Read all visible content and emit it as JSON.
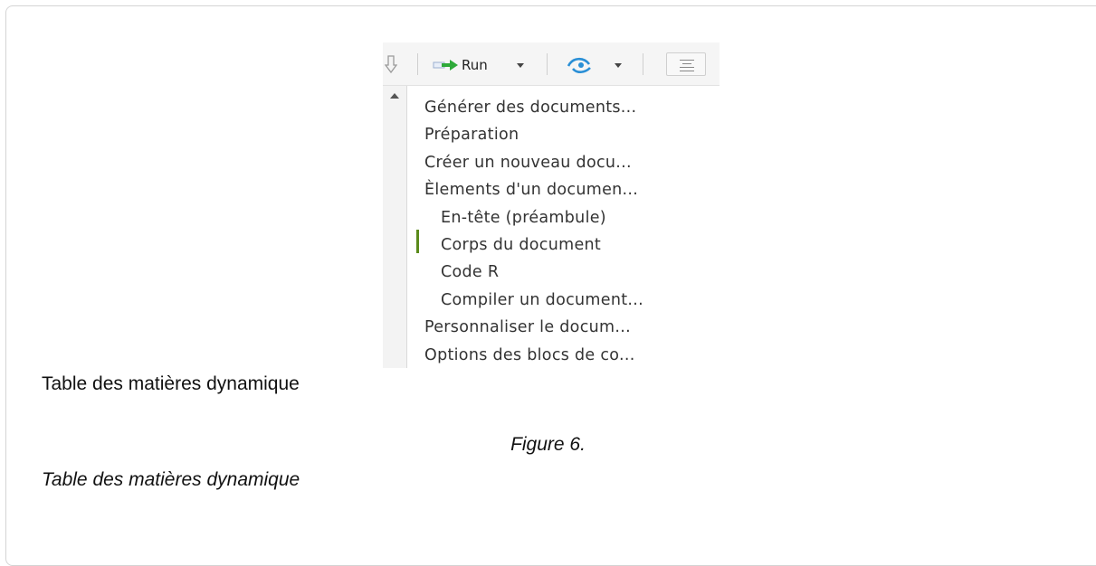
{
  "toolbar": {
    "run_label": "Run",
    "icons": [
      "download-arrow-icon",
      "run-arrow-icon",
      "publish-icon",
      "outline-icon"
    ]
  },
  "toc": {
    "items": [
      {
        "label": "Générer des documents...",
        "level": 1
      },
      {
        "label": "Préparation",
        "level": 1
      },
      {
        "label": "Créer un nouveau docu...",
        "level": 1
      },
      {
        "label": "Èlements d'un documen...",
        "level": 1
      },
      {
        "label": "En-tête (préambule)",
        "level": 2
      },
      {
        "label": "Corps du document",
        "level": 2,
        "current": true
      },
      {
        "label": "Code R",
        "level": 2
      },
      {
        "label": "Compiler un document...",
        "level": 2
      },
      {
        "label": "Personnaliser le docum...",
        "level": 1
      },
      {
        "label": "Options des blocs de co...",
        "level": 1
      }
    ]
  },
  "image_alt": "Table des matières dynamique",
  "figure": {
    "label": "Figure 6.",
    "caption": "Table des matières dynamique"
  },
  "colors": {
    "run_arrow": "#2eaa3a",
    "publish_blue": "#2a8fd6",
    "current_marker": "#5a8a1a"
  }
}
